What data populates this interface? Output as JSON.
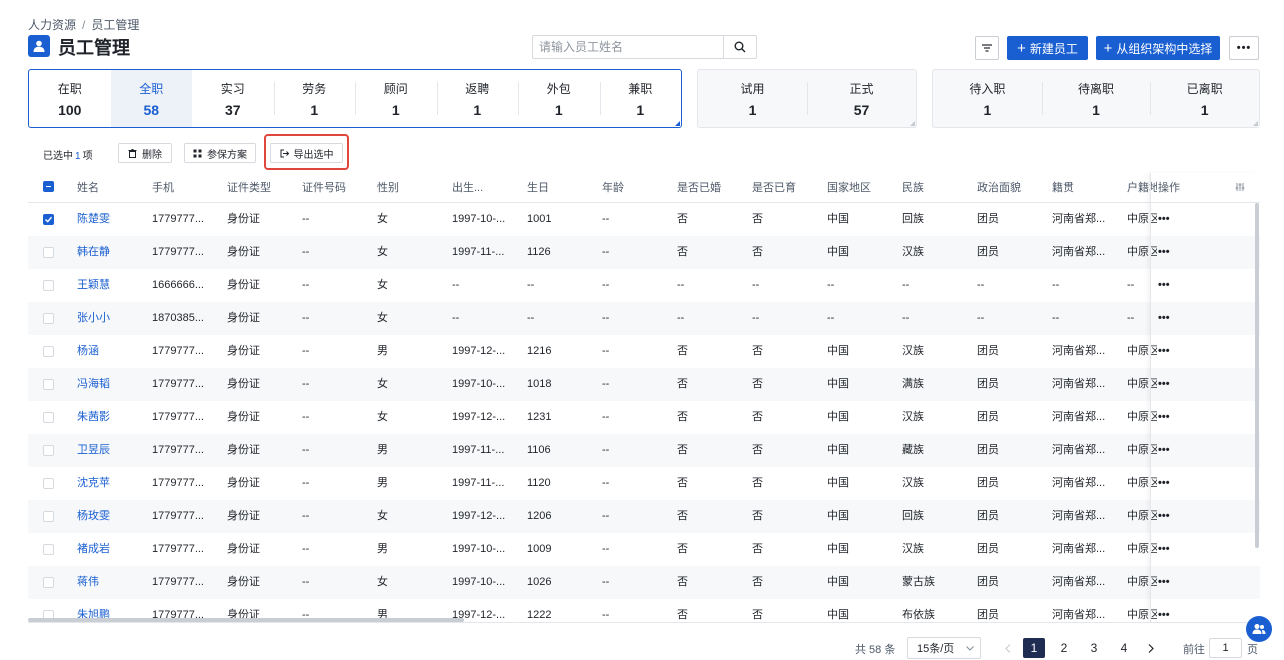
{
  "breadcrumb": {
    "parent": "人力资源",
    "separator": "/",
    "current": "员工管理"
  },
  "page_title": "员工管理",
  "search": {
    "placeholder": "请输入员工姓名",
    "value": ""
  },
  "toolbar": {
    "new_label": "新建员工",
    "org_label": "从组织架构中选择",
    "more_label": "•••"
  },
  "stats": {
    "group1": [
      {
        "label": "在职",
        "value": "100"
      },
      {
        "label": "全职",
        "value": "58",
        "active": true
      },
      {
        "label": "实习",
        "value": "37"
      },
      {
        "label": "劳务",
        "value": "1"
      },
      {
        "label": "顾问",
        "value": "1"
      },
      {
        "label": "返聘",
        "value": "1"
      },
      {
        "label": "外包",
        "value": "1"
      },
      {
        "label": "兼职",
        "value": "1"
      }
    ],
    "group2": [
      {
        "label": "试用",
        "value": "1"
      },
      {
        "label": "正式",
        "value": "57"
      }
    ],
    "group3": [
      {
        "label": "待入职",
        "value": "1"
      },
      {
        "label": "待离职",
        "value": "1"
      },
      {
        "label": "已离职",
        "value": "1"
      }
    ]
  },
  "selection": {
    "prefix": "已选中",
    "count": "1",
    "suffix": "项"
  },
  "actions": {
    "delete": "删除",
    "insurance": "参保方案",
    "export": "导出选中"
  },
  "table": {
    "columns": [
      "姓名",
      "手机",
      "证件类型",
      "证件号码",
      "性别",
      "出生...",
      "生日",
      "年龄",
      "是否已婚",
      "是否已育",
      "国家地区",
      "民族",
      "政治面貌",
      "籍贯",
      "户籍地",
      "操作"
    ],
    "rows": [
      {
        "checked": true,
        "cells": [
          "陈楚雯",
          "1779777...",
          "身份证",
          "--",
          "女",
          "1997-10-...",
          "1001",
          "--",
          "否",
          "否",
          "中国",
          "回族",
          "团员",
          "河南省郑...",
          "中原区"
        ]
      },
      {
        "checked": false,
        "cells": [
          "韩在静",
          "1779777...",
          "身份证",
          "--",
          "女",
          "1997-11-...",
          "1126",
          "--",
          "否",
          "否",
          "中国",
          "汉族",
          "团员",
          "河南省郑...",
          "中原区"
        ]
      },
      {
        "checked": false,
        "cells": [
          "王颖慧",
          "1666666...",
          "身份证",
          "--",
          "女",
          "--",
          "--",
          "--",
          "--",
          "--",
          "--",
          "--",
          "--",
          "--",
          "--"
        ]
      },
      {
        "checked": false,
        "cells": [
          "张小小",
          "1870385...",
          "身份证",
          "--",
          "女",
          "--",
          "--",
          "--",
          "--",
          "--",
          "--",
          "--",
          "--",
          "--",
          "--"
        ]
      },
      {
        "checked": false,
        "cells": [
          "杨涵",
          "1779777...",
          "身份证",
          "--",
          "男",
          "1997-12-...",
          "1216",
          "--",
          "否",
          "否",
          "中国",
          "汉族",
          "团员",
          "河南省郑...",
          "中原区"
        ]
      },
      {
        "checked": false,
        "cells": [
          "冯海韬",
          "1779777...",
          "身份证",
          "--",
          "女",
          "1997-10-...",
          "1018",
          "--",
          "否",
          "否",
          "中国",
          "满族",
          "团员",
          "河南省郑...",
          "中原区"
        ]
      },
      {
        "checked": false,
        "cells": [
          "朱茜影",
          "1779777...",
          "身份证",
          "--",
          "女",
          "1997-12-...",
          "1231",
          "--",
          "否",
          "否",
          "中国",
          "汉族",
          "团员",
          "河南省郑...",
          "中原区"
        ]
      },
      {
        "checked": false,
        "cells": [
          "卫昱辰",
          "1779777...",
          "身份证",
          "--",
          "男",
          "1997-11-...",
          "1106",
          "--",
          "否",
          "否",
          "中国",
          "藏族",
          "团员",
          "河南省郑...",
          "中原区"
        ]
      },
      {
        "checked": false,
        "cells": [
          "沈克苹",
          "1779777...",
          "身份证",
          "--",
          "男",
          "1997-11-...",
          "1120",
          "--",
          "否",
          "否",
          "中国",
          "汉族",
          "团员",
          "河南省郑...",
          "中原区"
        ]
      },
      {
        "checked": false,
        "cells": [
          "杨玫雯",
          "1779777...",
          "身份证",
          "--",
          "女",
          "1997-12-...",
          "1206",
          "--",
          "否",
          "否",
          "中国",
          "回族",
          "团员",
          "河南省郑...",
          "中原区"
        ]
      },
      {
        "checked": false,
        "cells": [
          "褚成岩",
          "1779777...",
          "身份证",
          "--",
          "男",
          "1997-10-...",
          "1009",
          "--",
          "否",
          "否",
          "中国",
          "汉族",
          "团员",
          "河南省郑...",
          "中原区"
        ]
      },
      {
        "checked": false,
        "cells": [
          "蒋伟",
          "1779777...",
          "身份证",
          "--",
          "女",
          "1997-10-...",
          "1026",
          "--",
          "否",
          "否",
          "中国",
          "蒙古族",
          "团员",
          "河南省郑...",
          "中原区"
        ]
      },
      {
        "checked": false,
        "cells": [
          "朱旭鹏",
          "1779777...",
          "身份证",
          "--",
          "男",
          "1997-12-...",
          "1222",
          "--",
          "否",
          "否",
          "中国",
          "布依族",
          "团员",
          "河南省郑...",
          "中原区"
        ]
      }
    ],
    "row_action": "•••"
  },
  "pagination": {
    "total": "共 58 条",
    "page_size": "15条/页",
    "pages": [
      "1",
      "2",
      "3",
      "4"
    ],
    "current": "1",
    "goto_prefix": "前往",
    "goto_value": "1",
    "goto_suffix": "页"
  },
  "colors": {
    "primary": "#1a5fd1",
    "highlight": "#e0473a",
    "pager_active": "#1f2d52"
  }
}
